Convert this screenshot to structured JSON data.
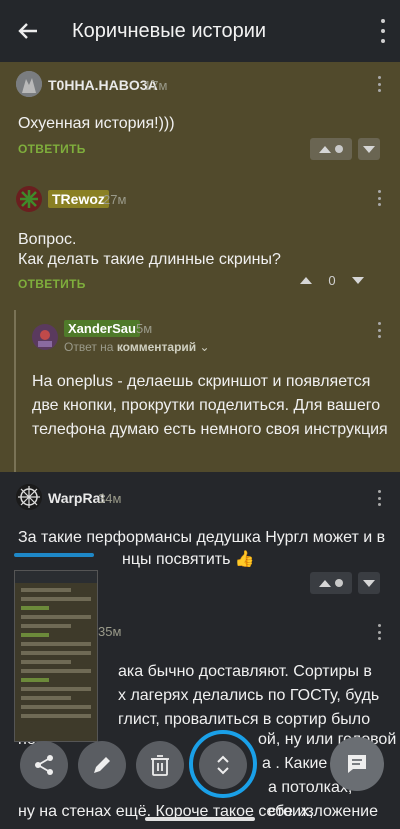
{
  "header": {
    "title": "Коричневые истории"
  },
  "comments": [
    {
      "user": "T0HHA.HABO3A",
      "time": "17м",
      "text": "Охуенная история!)))",
      "reply_label": "ОТВЕТИТЬ"
    },
    {
      "user": "TRewoz",
      "time": "27м",
      "text_line1": "Вопрос.",
      "text_line2": "Как делать такие длинные скрины?",
      "reply_label": "ОТВЕТИТЬ",
      "score": "0",
      "replies": [
        {
          "user": "XanderSau",
          "time": "5м",
          "reply_to_prefix": "Ответ на",
          "reply_to_target": "комментарий",
          "text_line1": "На oneplus - делаешь скриншот и появляется",
          "text_line2": "две кнопки, прокрутки поделиться. Для вашего",
          "text_line3": "телефона думаю есть немного своя инструкция"
        }
      ]
    },
    {
      "user": "WarpRat",
      "time": "34м",
      "text_line1": "За такие перформансы дедушка Нургл может и в",
      "text_line2_tail": "нцы посвятить 👍"
    }
  ],
  "background_comment": {
    "time": "35м",
    "line1": "ака бычно доставляют. Сортиры в",
    "line2": "х лагерях делались по ГОСТу, будь",
    "line3": "глист, провалиться в сортир было",
    "line4_a": "не",
    "line4_b": "ой, ну или головой",
    "line5_b": "а . Какие то",
    "line6_b": "а потолках, стоих,",
    "line7": "ну на стенах ещё. Короче такое себе изложение"
  },
  "actions": {
    "share_icon": "share-icon",
    "edit_icon": "pencil-icon",
    "delete_icon": "trash-icon",
    "scroll_icon": "scroll-updown-icon",
    "chat_icon": "comment-icon"
  },
  "colors": {
    "highlight_bg": "#514a2c",
    "app_bg": "#1f2124",
    "reply_green": "#7fae3c",
    "ring_blue": "#1aa0e8"
  }
}
